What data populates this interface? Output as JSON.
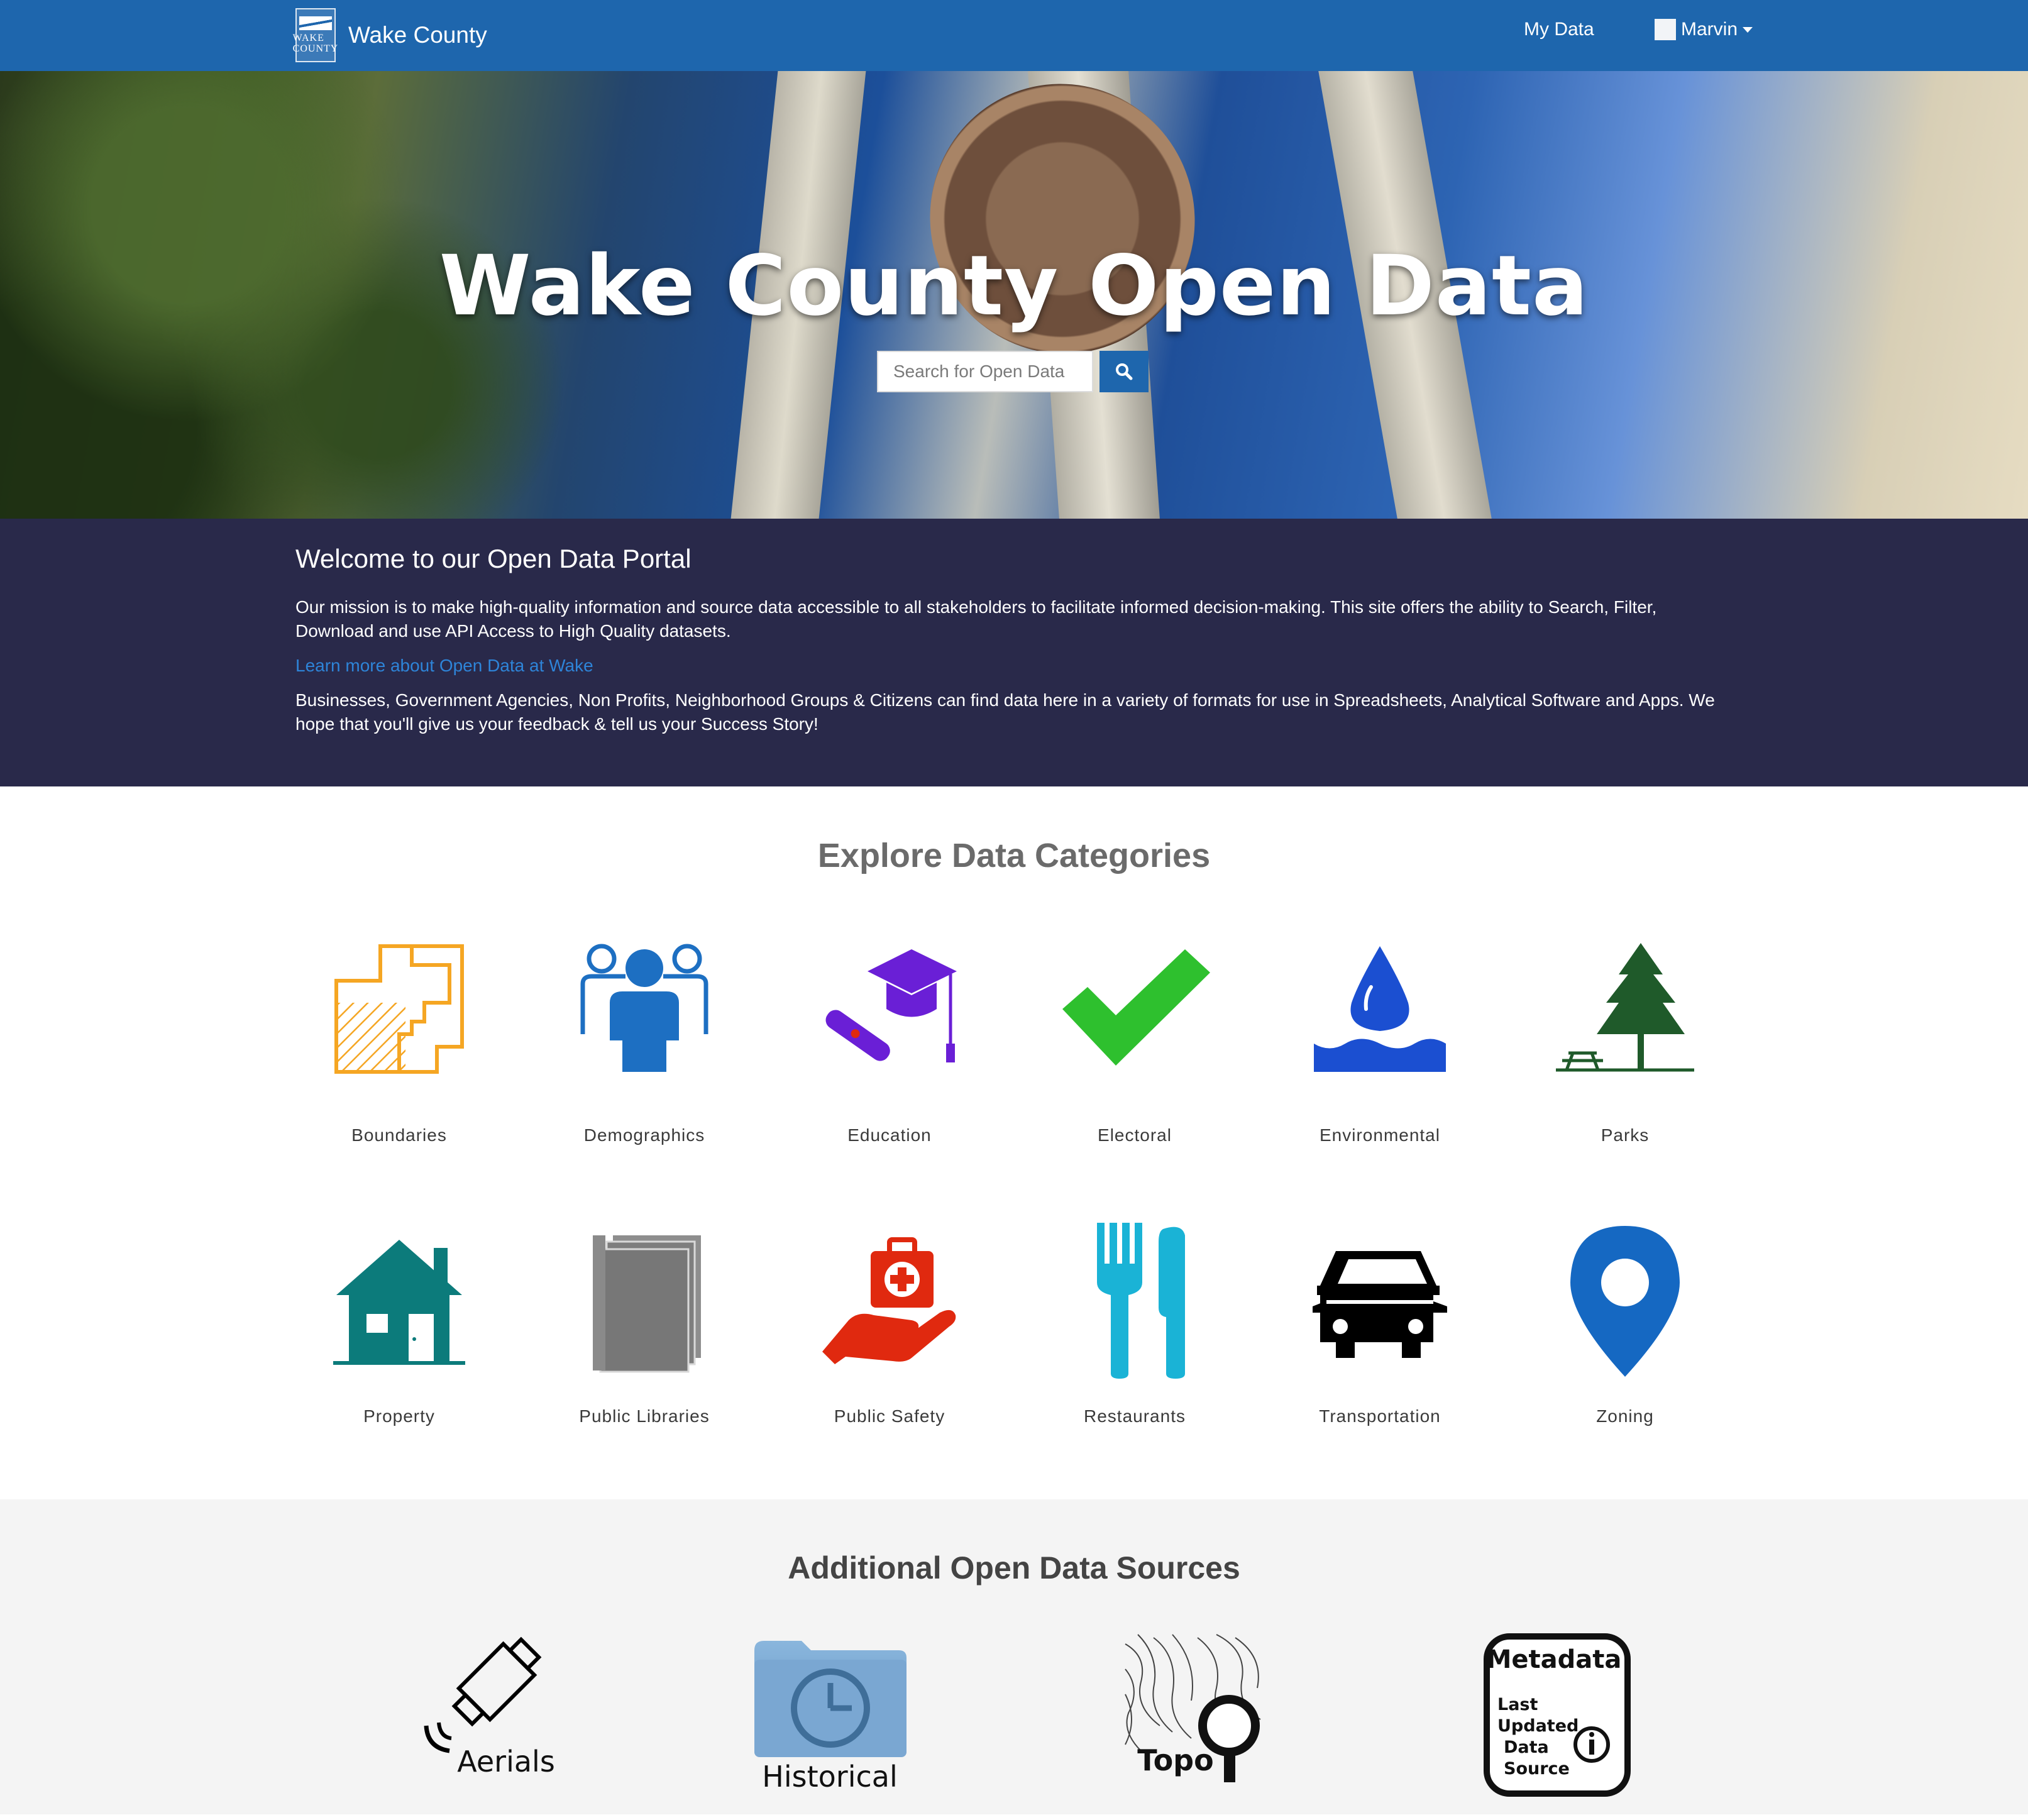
{
  "nav": {
    "logo_text": "WAKE COUNTY",
    "title": "Wake County",
    "my_data": "My Data",
    "user": "Marvin"
  },
  "hero": {
    "title": "Wake County Open Data",
    "search_placeholder": "Search for Open Data"
  },
  "welcome": {
    "heading": "Welcome to our Open Data Portal",
    "mission": "Our mission is to make high-quality information and source data accessible to all stakeholders to facilitate informed decision-making. This site offers the ability to Search, Filter, Download and use API Access to High Quality datasets.",
    "learn_more": "Learn more about Open Data at Wake",
    "audience": "Businesses, Government Agencies, Non Profits, Neighborhood Groups & Citizens can find data here in a variety of formats for use in Spreadsheets, Analytical Software and Apps. We hope that you'll give us your feedback & tell us your Success Story!"
  },
  "categories": {
    "title": "Explore Data Categories",
    "items": [
      {
        "label": "Boundaries",
        "icon": "boundaries-icon",
        "color": "#f5a623"
      },
      {
        "label": "Demographics",
        "icon": "people-icon",
        "color": "#1d6fc2"
      },
      {
        "label": "Education",
        "icon": "graduation-cap-icon",
        "color": "#6a1fd6"
      },
      {
        "label": "Electoral",
        "icon": "checkmark-icon",
        "color": "#2ec02e"
      },
      {
        "label": "Environmental",
        "icon": "water-drop-icon",
        "color": "#1b4fd1"
      },
      {
        "label": "Parks",
        "icon": "tree-icon",
        "color": "#1f5a2a"
      },
      {
        "label": "Property",
        "icon": "house-icon",
        "color": "#0c7b7b"
      },
      {
        "label": "Public Libraries",
        "icon": "books-icon",
        "color": "#7a7a7a"
      },
      {
        "label": "Public Safety",
        "icon": "first-aid-hand-icon",
        "color": "#e0290f"
      },
      {
        "label": "Restaurants",
        "icon": "fork-knife-icon",
        "color": "#1ab3d6"
      },
      {
        "label": "Transportation",
        "icon": "car-icon",
        "color": "#000000"
      },
      {
        "label": "Zoning",
        "icon": "map-pin-icon",
        "color": "#1568c2"
      }
    ]
  },
  "additional": {
    "title": "Additional Open Data Sources",
    "items": [
      {
        "label": "Aerials",
        "icon": "satellite-icon"
      },
      {
        "label": "Historical",
        "icon": "clock-folder-icon"
      },
      {
        "label": "Topo",
        "icon": "topo-magnifier-icon"
      },
      {
        "label": "Metadata",
        "icon": "metadata-info-icon",
        "lines": [
          "Last",
          "Updated",
          "Data",
          "Source"
        ]
      }
    ]
  }
}
